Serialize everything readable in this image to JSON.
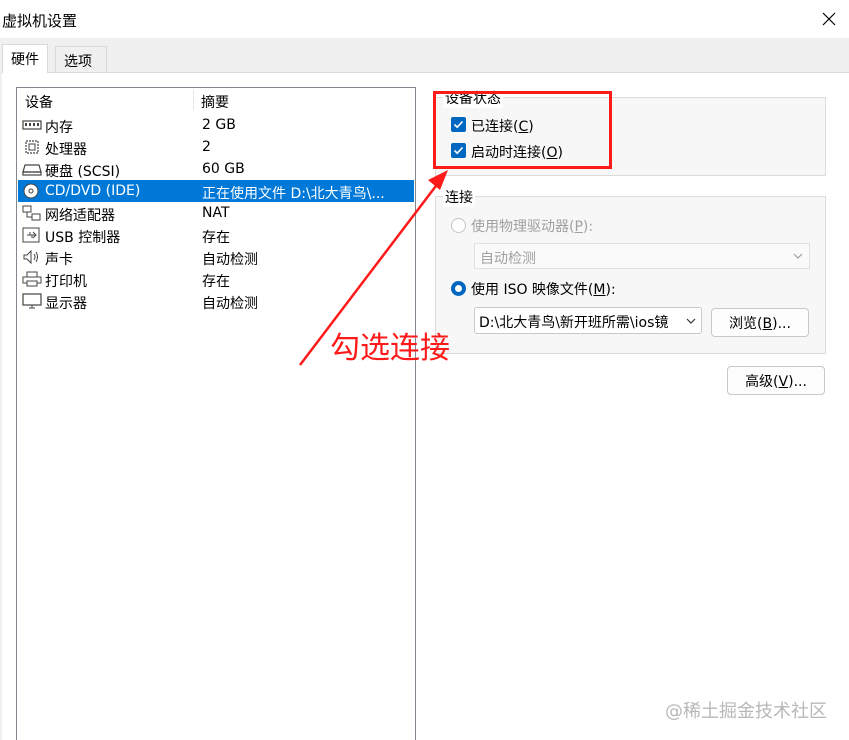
{
  "window": {
    "title": "虚拟机设置"
  },
  "tabs": [
    {
      "label": "硬件",
      "active": true
    },
    {
      "label": "选项",
      "active": false
    }
  ],
  "device_list": {
    "columns": [
      "设备",
      "摘要"
    ],
    "rows": [
      {
        "icon": "memory-icon",
        "name": "内存",
        "summary": "2 GB"
      },
      {
        "icon": "cpu-icon",
        "name": "处理器",
        "summary": "2"
      },
      {
        "icon": "hard-disk-icon",
        "name": "硬盘 (SCSI)",
        "summary": "60 GB"
      },
      {
        "icon": "cd-dvd-icon",
        "name": "CD/DVD (IDE)",
        "summary": "正在使用文件 D:\\北大青鸟\\...",
        "selected": true
      },
      {
        "icon": "network-adapter-icon",
        "name": "网络适配器",
        "summary": "NAT"
      },
      {
        "icon": "usb-icon",
        "name": "USB 控制器",
        "summary": "存在"
      },
      {
        "icon": "speaker-icon",
        "name": "声卡",
        "summary": "自动检测"
      },
      {
        "icon": "printer-icon",
        "name": "打印机",
        "summary": "存在"
      },
      {
        "icon": "monitor-icon",
        "name": "显示器",
        "summary": "自动检测"
      }
    ]
  },
  "device_status": {
    "title": "设备状态",
    "connected": {
      "label_pre": "已连接(",
      "mnemonic": "C",
      "label_post": ")",
      "checked": true
    },
    "connect_at_power_on": {
      "label_pre": "启动时连接(",
      "mnemonic": "O",
      "label_post": ")",
      "checked": true
    }
  },
  "connection": {
    "title": "连接",
    "physical_drive": {
      "label_pre": "使用物理驱动器(",
      "mnemonic": "P",
      "label_post": "):",
      "selected": false,
      "value": "自动检测"
    },
    "iso_image": {
      "label_pre": "使用 ISO 映像文件(",
      "mnemonic": "M",
      "label_post": "):",
      "selected": true,
      "value": "D:\\北大青鸟\\新开班所需\\ios镜"
    },
    "browse_button": {
      "label_pre": "浏览(",
      "mnemonic": "B",
      "label_post": ")..."
    }
  },
  "advanced_button": {
    "label_pre": "高级(",
    "mnemonic": "V",
    "label_post": ")..."
  },
  "annotation": {
    "text": "勾选连接"
  },
  "watermark": {
    "text": "@稀土掘金技术社区"
  },
  "colors": {
    "accent": "#0067c0",
    "selection": "#0078d7",
    "annotation_red": "#ff1a1a"
  }
}
